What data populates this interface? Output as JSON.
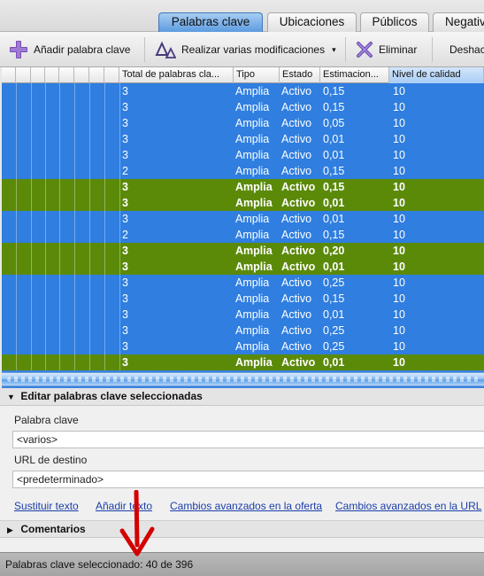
{
  "tabs": [
    {
      "label": "Palabras clave",
      "active": true
    },
    {
      "label": "Ubicaciones",
      "active": false
    },
    {
      "label": "Públicos",
      "active": false
    },
    {
      "label": "Negativas",
      "active": false
    }
  ],
  "toolbar": {
    "add_label": "Añadir palabra clave",
    "multi_label": "Realizar varias modificaciones",
    "multi_dropdown": "▾",
    "delete_label": "Eliminar",
    "undo_label": "Deshacer"
  },
  "table": {
    "columns": [
      "Total de palabras cla...",
      "Tipo",
      "Estado",
      "Estimacion...",
      "Nivel de calidad"
    ],
    "rows": [
      {
        "total": "3",
        "tipo": "Amplia",
        "estado": "Activo",
        "estimacion": "0,15",
        "nivel": "10",
        "color": "blue"
      },
      {
        "total": "3",
        "tipo": "Amplia",
        "estado": "Activo",
        "estimacion": "0,15",
        "nivel": "10",
        "color": "blue"
      },
      {
        "total": "3",
        "tipo": "Amplia",
        "estado": "Activo",
        "estimacion": "0,05",
        "nivel": "10",
        "color": "blue"
      },
      {
        "total": "3",
        "tipo": "Amplia",
        "estado": "Activo",
        "estimacion": "0,01",
        "nivel": "10",
        "color": "blue"
      },
      {
        "total": "3",
        "tipo": "Amplia",
        "estado": "Activo",
        "estimacion": "0,01",
        "nivel": "10",
        "color": "blue"
      },
      {
        "total": "2",
        "tipo": "Amplia",
        "estado": "Activo",
        "estimacion": "0,15",
        "nivel": "10",
        "color": "blue"
      },
      {
        "total": "3",
        "tipo": "Amplia",
        "estado": "Activo",
        "estimacion": "0,15",
        "nivel": "10",
        "color": "green"
      },
      {
        "total": "3",
        "tipo": "Amplia",
        "estado": "Activo",
        "estimacion": "0,01",
        "nivel": "10",
        "color": "green"
      },
      {
        "total": "3",
        "tipo": "Amplia",
        "estado": "Activo",
        "estimacion": "0,01",
        "nivel": "10",
        "color": "blue"
      },
      {
        "total": "2",
        "tipo": "Amplia",
        "estado": "Activo",
        "estimacion": "0,15",
        "nivel": "10",
        "color": "blue"
      },
      {
        "total": "3",
        "tipo": "Amplia",
        "estado": "Activo",
        "estimacion": "0,20",
        "nivel": "10",
        "color": "green"
      },
      {
        "total": "3",
        "tipo": "Amplia",
        "estado": "Activo",
        "estimacion": "0,01",
        "nivel": "10",
        "color": "green"
      },
      {
        "total": "3",
        "tipo": "Amplia",
        "estado": "Activo",
        "estimacion": "0,25",
        "nivel": "10",
        "color": "blue"
      },
      {
        "total": "3",
        "tipo": "Amplia",
        "estado": "Activo",
        "estimacion": "0,15",
        "nivel": "10",
        "color": "blue"
      },
      {
        "total": "3",
        "tipo": "Amplia",
        "estado": "Activo",
        "estimacion": "0,01",
        "nivel": "10",
        "color": "blue"
      },
      {
        "total": "3",
        "tipo": "Amplia",
        "estado": "Activo",
        "estimacion": "0,25",
        "nivel": "10",
        "color": "blue"
      },
      {
        "total": "3",
        "tipo": "Amplia",
        "estado": "Activo",
        "estimacion": "0,25",
        "nivel": "10",
        "color": "blue"
      },
      {
        "total": "3",
        "tipo": "Amplia",
        "estado": "Activo",
        "estimacion": "0,01",
        "nivel": "10",
        "color": "green"
      }
    ]
  },
  "edit_panel": {
    "title": "Editar palabras clave seleccionadas",
    "keyword_label": "Palabra clave",
    "keyword_value": "<varios>",
    "url_label": "URL de destino",
    "url_value": "<predeterminado>",
    "links": [
      "Sustituir texto",
      "Añadir texto",
      "Cambios avanzados en la oferta",
      "Cambios avanzados en la URL"
    ]
  },
  "comments": {
    "title": "Comentarios"
  },
  "status": {
    "text": "Palabras clave seleccionado: 40 de 396"
  },
  "colors": {
    "selected_blue": "#2f7ee0",
    "highlight_green": "#5b8a09",
    "arrow_red": "#d40000"
  }
}
